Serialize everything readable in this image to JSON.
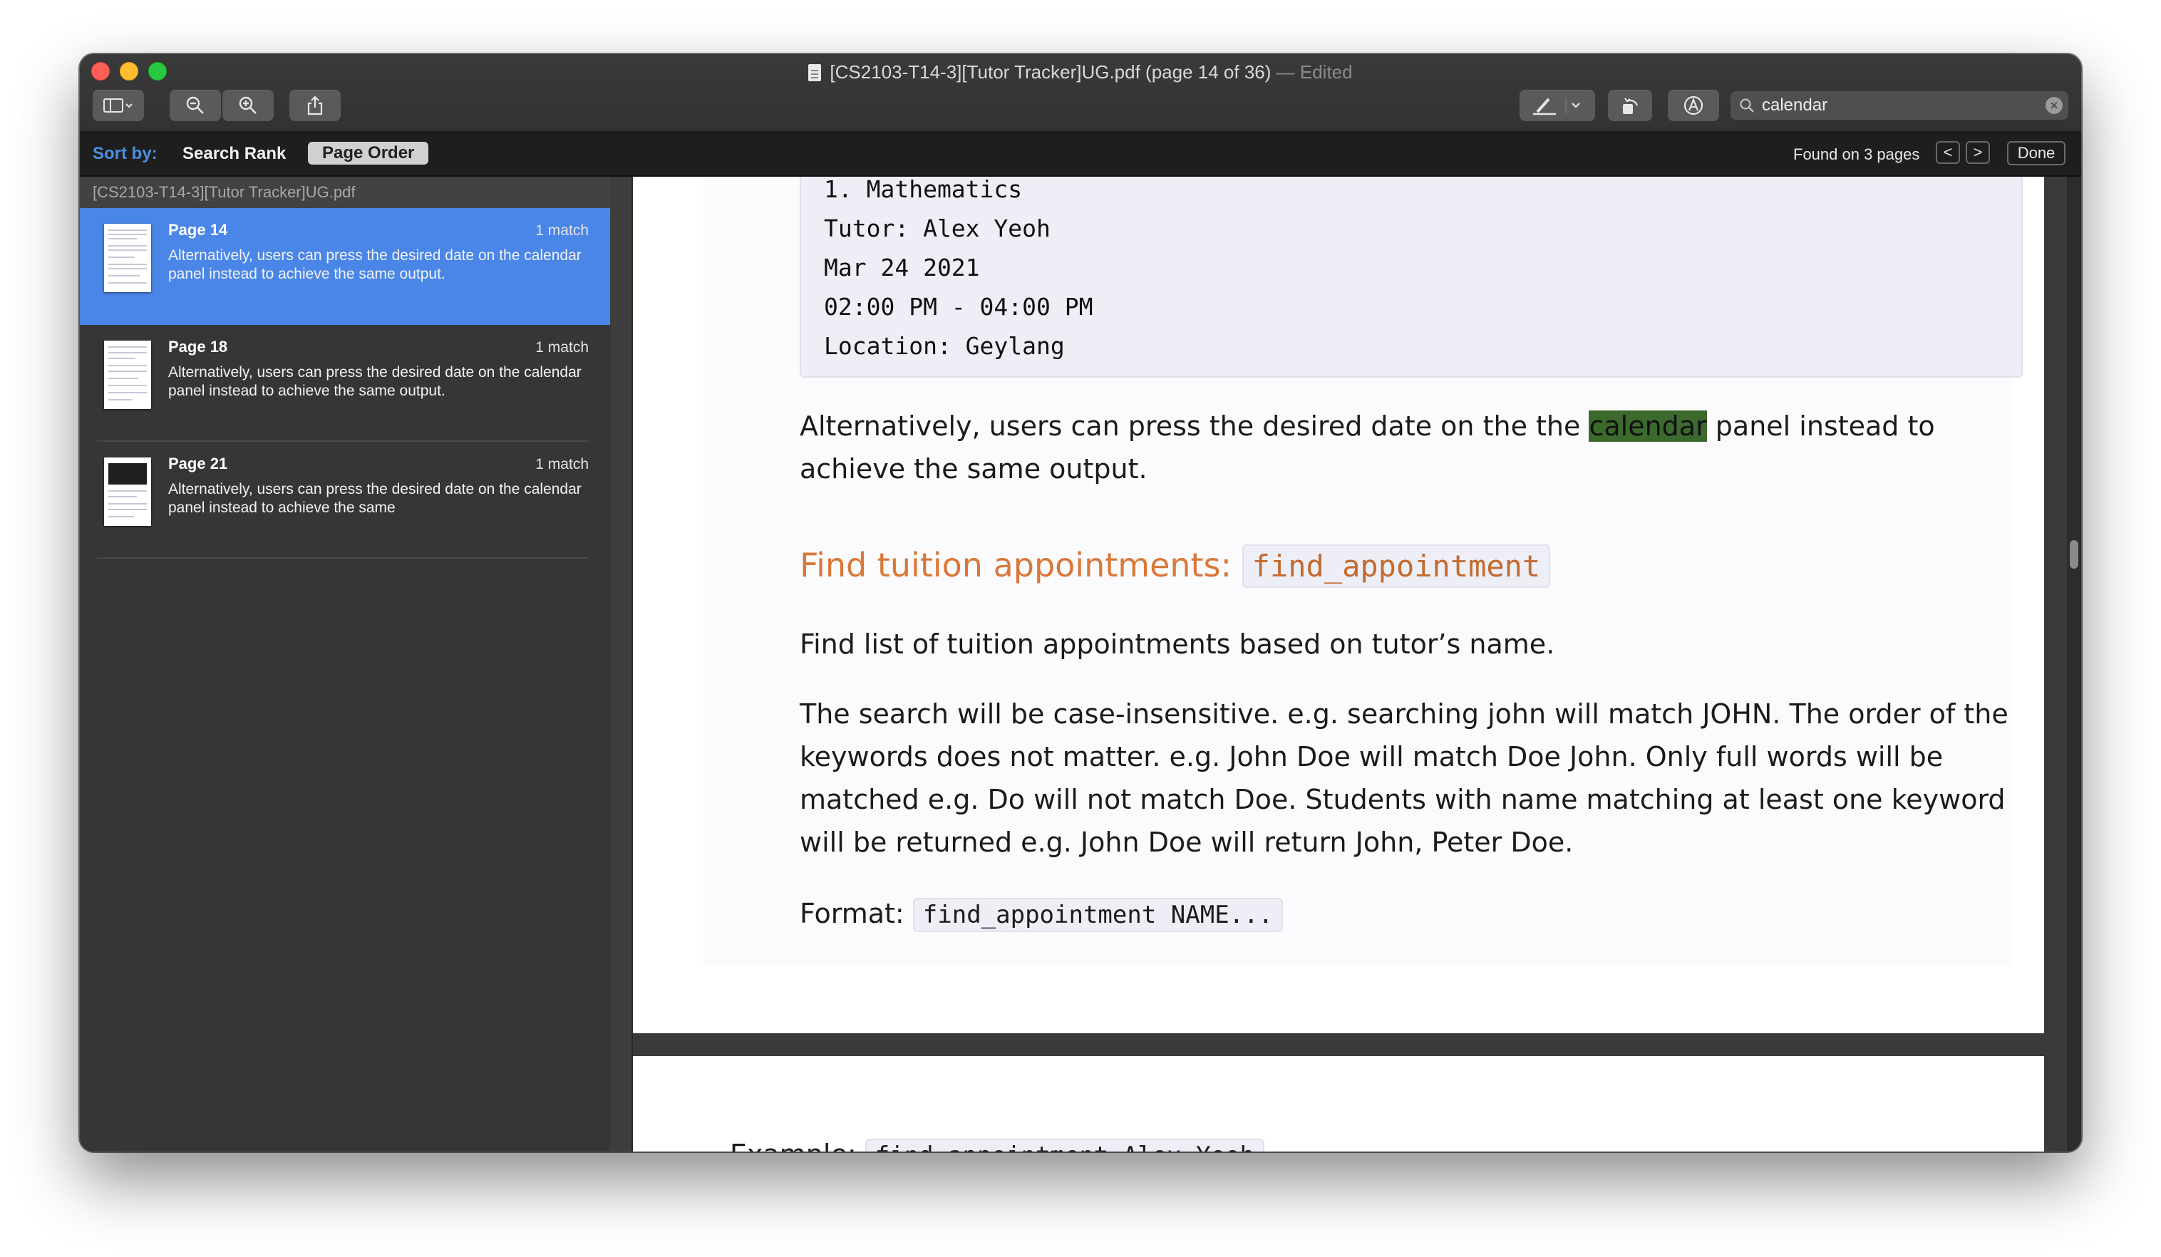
{
  "window": {
    "title": "[CS2103-T14-3][Tutor Tracker]UG.pdf (page 14 of 36)",
    "edited": "— Edited"
  },
  "toolbar": {
    "search_value": "calendar",
    "icons": [
      "sidebar-icon",
      "zoom-out-icon",
      "zoom-in-icon",
      "share-icon",
      "highlight-pen-icon",
      "rotate-icon",
      "markup-icon"
    ]
  },
  "findbar": {
    "sort_label": "Sort by:",
    "search_rank": "Search Rank",
    "page_order": "Page Order",
    "found": "Found on 3 pages",
    "prev": "<",
    "next": ">",
    "done": "Done"
  },
  "sidebar": {
    "file": "[CS2103-T14-3][Tutor Tracker]UG.pdf",
    "results": [
      {
        "page": "Page 14",
        "count": "1 match",
        "snippet": "Alternatively, users can press the desired date on the calendar panel instead to achieve the same output.",
        "selected": true
      },
      {
        "page": "Page 18",
        "count": "1 match",
        "snippet": "Alternatively, users can press the desired date on the calendar panel instead to achieve the same output.",
        "selected": false
      },
      {
        "page": "Page 21",
        "count": "1 match",
        "snippet": "Alternatively, users can press the desired date on the calendar panel instead to achieve the same",
        "selected": false
      }
    ]
  },
  "document": {
    "code_lines": [
      "1. Mathematics",
      "Tutor: Alex Yeoh",
      "Mar 24 2021",
      "02:00 PM - 04:00 PM",
      "Location: Geylang"
    ],
    "alt_before": "Alternatively, users can press the desired date on the the ",
    "alt_highlight": "calendar",
    "alt_after": " panel instead to achieve the same output.",
    "heading_text": "Find tuition appointments: ",
    "heading_code": "find_appointment",
    "find_list": "Find list of tuition appointments based on tutor’s name.",
    "search_desc": "The search will be case-insensitive. e.g. searching john will match JOHN. The order of the keywords does not matter. e.g. John Doe will match Doe John. Only full words will be matched e.g. Do will not match Doe. Students with name matching at least one keyword will be returned e.g. John Doe will return John, Peter Doe.",
    "format_label": "Format: ",
    "format_code": "find_appointment NAME...",
    "example_label": "Example: ",
    "example_code": "find_appointment Alex Yeoh"
  },
  "colors": {
    "selection": "#4a86e8",
    "highlight": "#3c6a2d",
    "heading": "#d9783a",
    "sort_label": "#4a90e2"
  }
}
